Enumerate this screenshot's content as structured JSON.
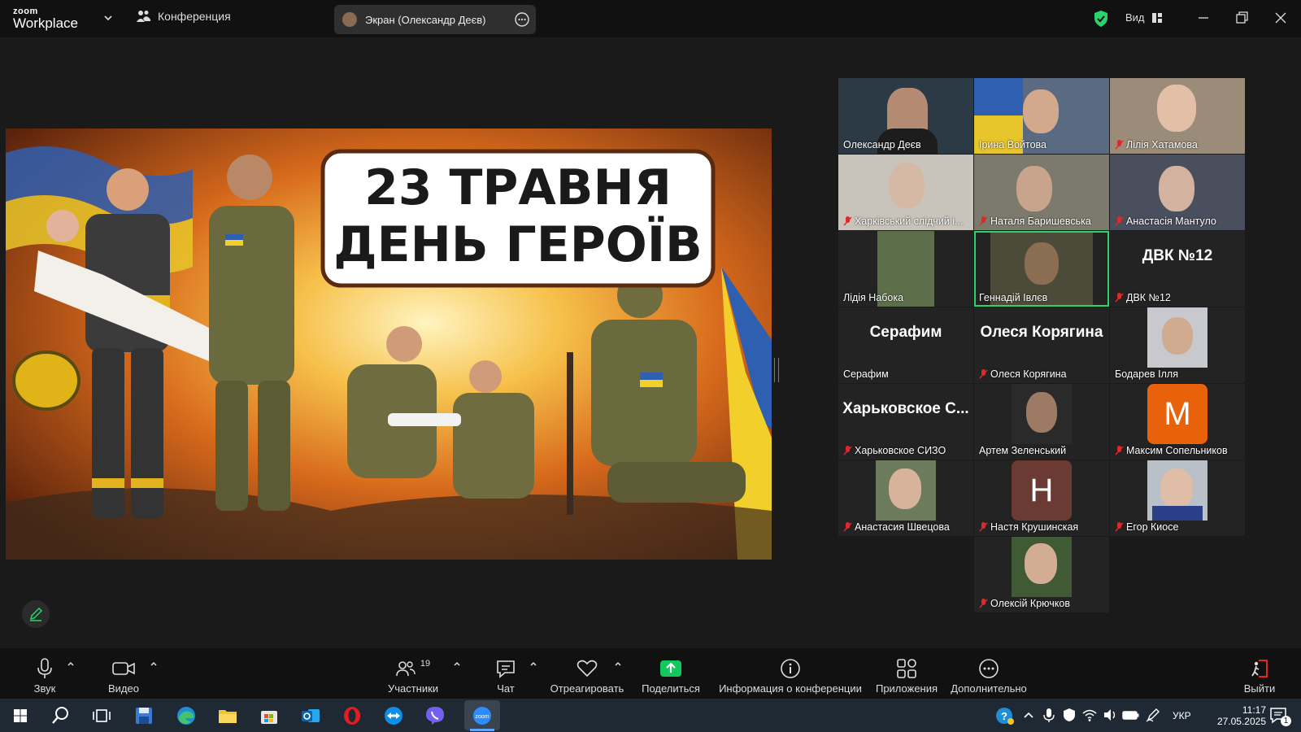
{
  "titlebar": {
    "logo_top": "zoom",
    "logo_bottom": "Workplace",
    "meeting_menu": "Конференция",
    "screen_share_label": "Экран (Олександр Деєв)",
    "view_label": "Вид"
  },
  "shared_screen": {
    "headline_line1": "23 ТРАВНЯ",
    "headline_line2": "ДЕНЬ ГЕРОЇВ"
  },
  "participants": [
    {
      "name": "Олександр Деєв",
      "muted": false,
      "kind": "video"
    },
    {
      "name": "Ірина Войтова",
      "muted": false,
      "kind": "video"
    },
    {
      "name": "Лілія Хатамова",
      "muted": true,
      "kind": "video"
    },
    {
      "name": "Харківський слідчий і...",
      "muted": true,
      "kind": "video"
    },
    {
      "name": "Наталя Баришевська",
      "muted": true,
      "kind": "video"
    },
    {
      "name": "Анастасія Мантуло",
      "muted": true,
      "kind": "video"
    },
    {
      "name": "Лідія Набока",
      "muted": false,
      "kind": "video"
    },
    {
      "name": "Геннадій Івлєв",
      "muted": false,
      "kind": "video",
      "active": true
    },
    {
      "name": "ДВК №12",
      "muted": true,
      "kind": "text",
      "display": "ДВК №12"
    },
    {
      "name": "Серафим",
      "muted": false,
      "kind": "text",
      "display": "Серафим"
    },
    {
      "name": "Олеся Корягина",
      "muted": true,
      "kind": "text",
      "display": "Олеся Корягина"
    },
    {
      "name": "Бодарев Ілля",
      "muted": false,
      "kind": "video"
    },
    {
      "name": "Харьковское СИЗО",
      "muted": true,
      "kind": "text",
      "display": "Харьковское С..."
    },
    {
      "name": "Артем Зеленський",
      "muted": false,
      "kind": "video"
    },
    {
      "name": "Максим Сопельников",
      "muted": true,
      "kind": "letter",
      "display": "M",
      "color": "#e8620c"
    },
    {
      "name": "Анастасия Швецова",
      "muted": true,
      "kind": "video"
    },
    {
      "name": "Настя Крушинская",
      "muted": true,
      "kind": "letter",
      "display": "H",
      "color": "#6b3a33"
    },
    {
      "name": "Егор Киосе",
      "muted": true,
      "kind": "video"
    },
    {
      "name": "Олексій Крючков",
      "muted": true,
      "kind": "video"
    }
  ],
  "toolbar": {
    "audio": "Звук",
    "video": "Видео",
    "participants": "Участники",
    "participants_count": "19",
    "chat": "Чат",
    "react": "Отреагировать",
    "share": "Поделиться",
    "info": "Информация о конференции",
    "apps": "Приложения",
    "more": "Дополнительно",
    "leave": "Выйти"
  },
  "taskbar": {
    "language": "УКР",
    "time": "11:17",
    "date": "27.05.2025",
    "notifications": "1"
  },
  "colors": {
    "accent_green": "#2bd46a",
    "share_green": "#12c75c",
    "leave_red": "#e02828"
  }
}
